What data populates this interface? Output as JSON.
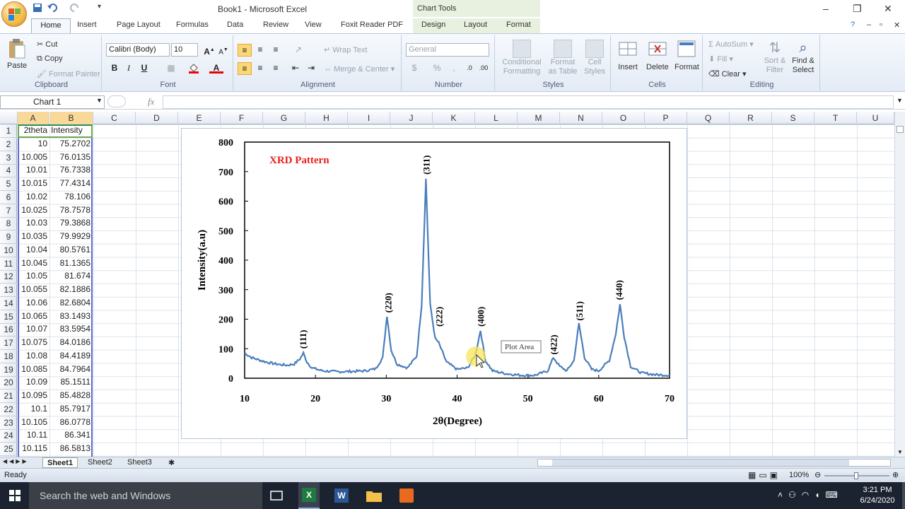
{
  "window": {
    "title": "Book1 - Microsoft Excel",
    "context_tab": "Chart Tools",
    "controls": [
      "–",
      "❐",
      "✕"
    ]
  },
  "tabs": [
    "Home",
    "Insert",
    "Page Layout",
    "Formulas",
    "Data",
    "Review",
    "View",
    "Foxit Reader PDF",
    "Design",
    "Layout",
    "Format"
  ],
  "ribbon": {
    "clipboard": {
      "label": "Clipboard",
      "paste": "Paste",
      "cut": "Cut",
      "copy": "Copy",
      "format_painter": "Format Painter"
    },
    "font": {
      "label": "Font",
      "name": "Calibri (Body)",
      "size": "10",
      "bold": "B",
      "italic": "I",
      "underline": "U"
    },
    "alignment": {
      "label": "Alignment",
      "wrap": "Wrap Text",
      "merge": "Merge & Center"
    },
    "number": {
      "label": "Number",
      "format": "General",
      "currency": "$",
      "percent": "%"
    },
    "styles": {
      "label": "Styles",
      "conditional": "Conditional Formatting",
      "as_table": "Format as Table",
      "cell_styles": "Cell Styles"
    },
    "cells": {
      "label": "Cells",
      "insert": "Insert",
      "delete": "Delete",
      "format": "Format"
    },
    "editing": {
      "label": "Editing",
      "autosum": "AutoSum",
      "fill": "Fill",
      "clear": "Clear",
      "sort": "Sort & Filter",
      "find": "Find & Select"
    }
  },
  "formula_bar": {
    "name_box": "Chart 1",
    "fx": "fx",
    "value": ""
  },
  "columns": [
    "A",
    "B",
    "C",
    "D",
    "E",
    "F",
    "G",
    "H",
    "I",
    "J",
    "K",
    "L",
    "M",
    "N",
    "O",
    "P",
    "Q",
    "R",
    "S",
    "T",
    "U"
  ],
  "rows": [
    [
      "2theta",
      "Intensity"
    ],
    [
      "10",
      "75.2702"
    ],
    [
      "10.005",
      "76.0135"
    ],
    [
      "10.01",
      "76.7338"
    ],
    [
      "10.015",
      "77.4314"
    ],
    [
      "10.02",
      "78.106"
    ],
    [
      "10.025",
      "78.7578"
    ],
    [
      "10.03",
      "79.3868"
    ],
    [
      "10.035",
      "79.9929"
    ],
    [
      "10.04",
      "80.5761"
    ],
    [
      "10.045",
      "81.1365"
    ],
    [
      "10.05",
      "81.674"
    ],
    [
      "10.055",
      "82.1886"
    ],
    [
      "10.06",
      "82.6804"
    ],
    [
      "10.065",
      "83.1493"
    ],
    [
      "10.07",
      "83.5954"
    ],
    [
      "10.075",
      "84.0186"
    ],
    [
      "10.08",
      "84.4189"
    ],
    [
      "10.085",
      "84.7964"
    ],
    [
      "10.09",
      "85.1511"
    ],
    [
      "10.095",
      "85.4828"
    ],
    [
      "10.1",
      "85.7917"
    ],
    [
      "10.105",
      "86.0778"
    ],
    [
      "10.11",
      "86.341"
    ],
    [
      "10.115",
      "86.5813"
    ]
  ],
  "chart_data": {
    "type": "line",
    "title": "XRD Pattern",
    "xlabel": "2θ(Degree)",
    "ylabel": "Intensity(a.u)",
    "xlim": [
      10,
      70
    ],
    "ylim": [
      0,
      800
    ],
    "xticks": [
      10,
      20,
      30,
      40,
      50,
      60,
      70
    ],
    "yticks": [
      0,
      100,
      200,
      300,
      400,
      500,
      600,
      700,
      800
    ],
    "grid": false,
    "color": "#4a7ebb",
    "series": [
      {
        "x": [
          10,
          11,
          12,
          13,
          14,
          15,
          16,
          17,
          17.8,
          18.3,
          18.8,
          19.5,
          21,
          23,
          25,
          27,
          28.5,
          29.5,
          30.1,
          30.7,
          31.5,
          33,
          34.3,
          35.0,
          35.6,
          36.2,
          36.9,
          37.4,
          38.5,
          40,
          41.5,
          42.6,
          43.3,
          44.0,
          45,
          47,
          49,
          51,
          52.8,
          53.6,
          54.5,
          55.5,
          56.5,
          57.2,
          58,
          59,
          60,
          61.5,
          62.4,
          63.0,
          63.6,
          64.5,
          66,
          68,
          70
        ],
        "y": [
          85,
          70,
          62,
          55,
          50,
          46,
          44,
          48,
          65,
          85,
          55,
          35,
          25,
          22,
          23,
          25,
          32,
          70,
          212,
          95,
          48,
          35,
          75,
          250,
          675,
          250,
          135,
          120,
          55,
          30,
          35,
          80,
          162,
          60,
          25,
          15,
          10,
          10,
          25,
          70,
          40,
          25,
          60,
          185,
          70,
          30,
          25,
          60,
          150,
          250,
          140,
          40,
          18,
          12,
          10
        ]
      }
    ],
    "annotations": [
      {
        "label": "(111)",
        "x": 18.2,
        "y": 100
      },
      {
        "label": "(220)",
        "x": 30.2,
        "y": 222
      },
      {
        "label": "(311)",
        "x": 35.6,
        "y": 690
      },
      {
        "label": "(222)",
        "x": 37.4,
        "y": 175
      },
      {
        "label": "(400)",
        "x": 43.3,
        "y": 175
      },
      {
        "label": "(422)",
        "x": 53.6,
        "y": 80
      },
      {
        "label": "(511)",
        "x": 57.2,
        "y": 195
      },
      {
        "label": "(440)",
        "x": 62.8,
        "y": 265
      }
    ],
    "tooltip": "Plot Area"
  },
  "sheets": [
    "Sheet1",
    "Sheet2",
    "Sheet3"
  ],
  "status": {
    "ready": "Ready",
    "zoom": "100%"
  },
  "taskbar": {
    "search_placeholder": "Search the web and Windows",
    "time": "3:21 PM",
    "date": "6/24/2020"
  }
}
